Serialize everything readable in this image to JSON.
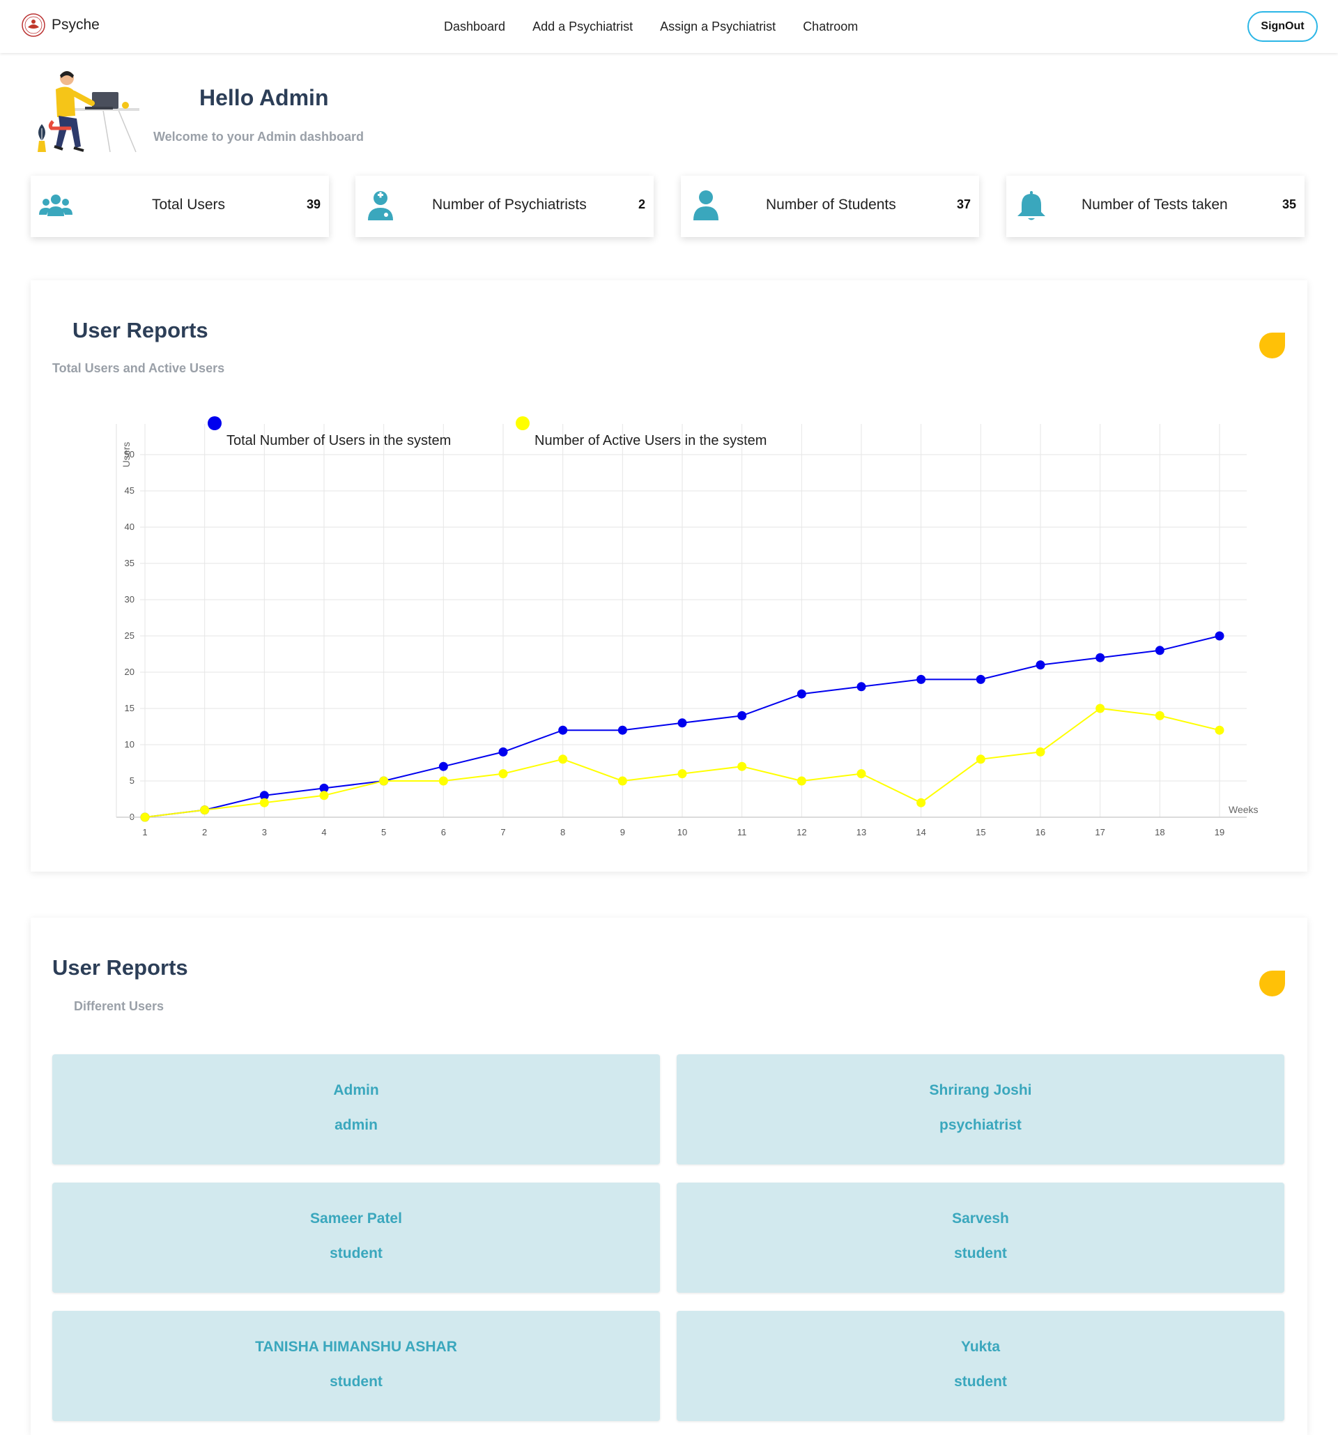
{
  "app": {
    "brand": "Psyche",
    "nav": [
      "Dashboard",
      "Add a Psychiatrist",
      "Assign a Psychiatrist",
      "Chatroom"
    ],
    "signout": "SignOut"
  },
  "hero": {
    "title": "Hello Admin",
    "subtitle": "Welcome to your Admin dashboard"
  },
  "stats": [
    {
      "label": "Total Users",
      "value": "39",
      "icon": "users-icon"
    },
    {
      "label": "Number of Psychiatrists",
      "value": "2",
      "icon": "doctor-icon"
    },
    {
      "label": "Number of Students",
      "value": "37",
      "icon": "user-icon"
    },
    {
      "label": "Number of Tests taken",
      "value": "35",
      "icon": "bell-icon"
    }
  ],
  "colors": {
    "accent": "#3aa7bd",
    "title": "#2c3e57",
    "muted": "#9aa0a8",
    "dot": "#ffc107",
    "card_bg": "#d2e9ee",
    "series_total": "#0000ee",
    "series_active": "#ffff00"
  },
  "reports": {
    "title": "User Reports",
    "subtitle": "Total Users and Active Users"
  },
  "chart_data": {
    "type": "line",
    "xlabel": "Weeks",
    "ylabel": "Users",
    "ylim": [
      0,
      50
    ],
    "yticks": [
      0,
      5,
      10,
      15,
      20,
      25,
      30,
      35,
      40,
      45,
      50
    ],
    "grid": true,
    "legend": "top",
    "x": [
      1,
      2,
      3,
      4,
      5,
      6,
      7,
      8,
      9,
      10,
      11,
      12,
      13,
      14,
      15,
      16,
      17,
      18,
      19
    ],
    "series": [
      {
        "name": "Total Number of Users in the system",
        "color": "#0000ee",
        "values": [
          0,
          1,
          3,
          4,
          5,
          7,
          9,
          12,
          12,
          13,
          14,
          17,
          18,
          19,
          19,
          21,
          22,
          23,
          25
        ]
      },
      {
        "name": "Number of Active Users in the system",
        "color": "#ffff00",
        "values": [
          0,
          1,
          2,
          3,
          5,
          5,
          6,
          8,
          5,
          6,
          7,
          5,
          6,
          2,
          8,
          9,
          15,
          14,
          12
        ]
      }
    ]
  },
  "user_reports": {
    "title": "User Reports",
    "subtitle": "Different Users",
    "users": [
      {
        "name": "Admin",
        "role": "admin"
      },
      {
        "name": "Shrirang Joshi",
        "role": "psychiatrist"
      },
      {
        "name": "Sameer Patel",
        "role": "student"
      },
      {
        "name": "Sarvesh",
        "role": "student"
      },
      {
        "name": "TANISHA HIMANSHU ASHAR",
        "role": "student"
      },
      {
        "name": "Yukta",
        "role": "student"
      }
    ]
  }
}
